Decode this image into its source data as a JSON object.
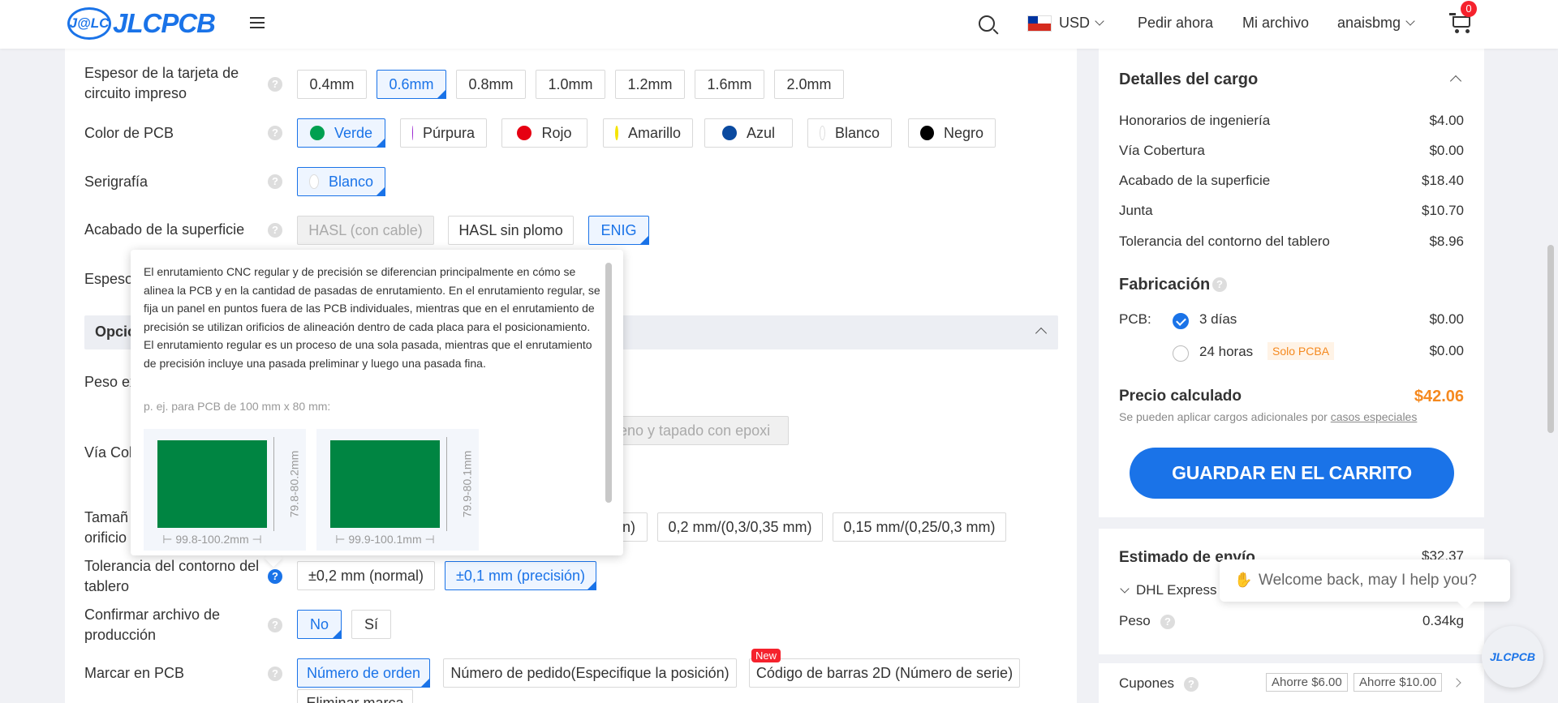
{
  "header": {
    "logo_badge": "J@LC",
    "logo_text": "JLCPCB",
    "currency": "USD",
    "nav": [
      "Pedir ahora",
      "Mi archivo",
      "anaisbmg"
    ],
    "cart_count": "0"
  },
  "form": {
    "thickness": {
      "label_line1": "Espesor de la tarjeta de",
      "label_line2": "circuito impreso",
      "options": [
        "0.4mm",
        "0.6mm",
        "0.8mm",
        "1.0mm",
        "1.2mm",
        "1.6mm",
        "2.0mm"
      ],
      "selected": "0.6mm"
    },
    "pcb_color": {
      "label": "Color de PCB",
      "options": [
        {
          "label": "Verde",
          "color": "#00a050"
        },
        {
          "label": "Púrpura",
          "color": "#9b27d1"
        },
        {
          "label": "Rojo",
          "color": "#e60012"
        },
        {
          "label": "Amarillo",
          "color": "#f5e400"
        },
        {
          "label": "Azul",
          "color": "#0a4aa0"
        },
        {
          "label": "Blanco",
          "color": "#ffffff"
        },
        {
          "label": "Negro",
          "color": "#000000"
        }
      ],
      "selected": "Verde"
    },
    "silkscreen": {
      "label": "Serigrafía",
      "option": "Blanco"
    },
    "surface_finish": {
      "label": "Acabado de la superficie",
      "options": [
        "HASL (con cable)",
        "HASL sin plomo",
        "ENIG"
      ],
      "selected": "ENIG"
    },
    "partial_label": "Espeso",
    "section_partial": "Opcio",
    "weight_partial": "Peso ex",
    "via_partial": "Vía Cob",
    "via_option_partial": "lleno y tapado con epoxi",
    "hole_partial_line1": "Tamañ",
    "hole_partial_line2": "orificio",
    "hole_options": [
      "n)",
      "0,2 mm/(0,3/0,35 mm)",
      "0,15 mm/(0,25/0,3 mm)"
    ],
    "outline_tolerance": {
      "label_line1": "Tolerancia del contorno del",
      "label_line2": "tablero",
      "options": [
        "±0,2 mm (normal)",
        "±0,1 mm (precisión)"
      ],
      "selected": "±0,1 mm (precisión)"
    },
    "confirm_file": {
      "label_line1": "Confirmar archivo de",
      "label_line2": "producción",
      "options": [
        "No",
        "Sí"
      ],
      "selected": "No"
    },
    "mark": {
      "label": "Marcar en PCB",
      "options": [
        "Número de orden",
        "Número de pedido(Especifique la posición)",
        "Código de barras 2D (Número de serie)"
      ],
      "selected": "Número de orden",
      "new_tag": "New",
      "partial_option": "Eliminar marca"
    }
  },
  "tooltip": {
    "text": "El enrutamiento CNC regular y de precisión se diferencian principalmente en cómo se alinea la PCB y en la cantidad de pasadas de enrutamiento. En el enrutamiento regular, se fija un panel en puntos fuera de las PCB individuales, mientras que en el enrutamiento de precisión se utilizan orificios de alineación dentro de cada placa para el posicionamiento. El enrutamiento regular es un proceso de una sola pasada, mientras que el enrutamiento de precisión incluye una pasada preliminar y luego una pasada fina.",
    "example": "p. ej. para PCB de 100 mm x 80 mm:",
    "boards": [
      {
        "height": "79.8-80.2mm",
        "width": "99.8-100.2mm"
      },
      {
        "height": "79.9-80.1mm",
        "width": "99.9-100.1mm"
      }
    ]
  },
  "charges": {
    "title": "Detalles del cargo",
    "items": [
      {
        "label": "Honorarios de ingeniería",
        "value": "$4.00"
      },
      {
        "label": "Vía Cobertura",
        "value": "$0.00"
      },
      {
        "label": "Acabado de la superficie",
        "value": "$18.40"
      },
      {
        "label": "Junta",
        "value": "$10.70"
      },
      {
        "label": "Tolerancia del contorno del tablero",
        "value": "$8.96"
      }
    ],
    "fabrication_title": "Fabricación",
    "pcb_label": "PCB:",
    "build_options": [
      {
        "label": "3 días",
        "value": "$0.00"
      },
      {
        "label": "24 horas",
        "value": "$0.00",
        "tag": "Solo PCBA"
      }
    ],
    "calculated_label": "Precio calculado",
    "calculated_value": "$42.06",
    "note_prefix": "Se pueden aplicar cargos adicionales por",
    "note_link": "casos especiales",
    "cart_button": "GUARDAR EN EL CARRITO"
  },
  "shipping": {
    "title": "Estimado de envío",
    "price_partial": "$32.37",
    "carrier": "DHL Express",
    "weight_label": "Peso",
    "weight_value": "0.34kg"
  },
  "coupons": {
    "label": "Cupones",
    "tags": [
      "Ahorre $6.00",
      "Ahorre $10.00"
    ]
  },
  "chat": {
    "message": "Welcome back, may I help you?",
    "avatar": "JLCPCB"
  }
}
